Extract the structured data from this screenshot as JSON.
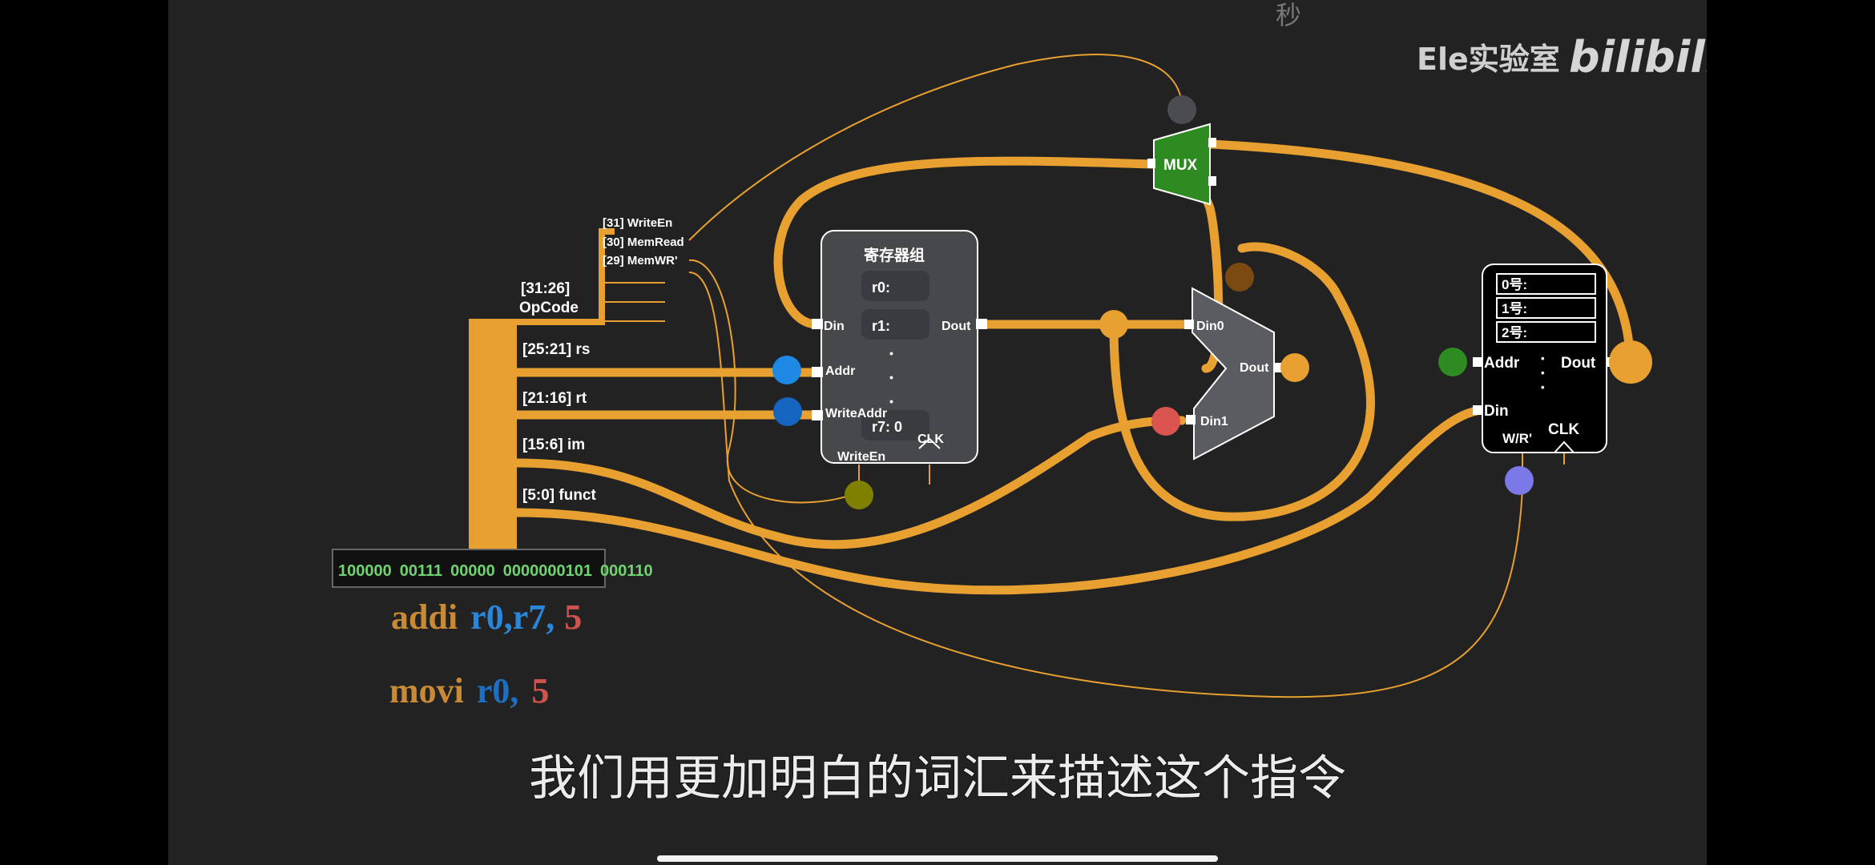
{
  "watermark": {
    "top_char": "秒",
    "channel": "Ele实验室",
    "brand": "bilibili"
  },
  "colors": {
    "wire": "#e8a030",
    "bg": "#222222",
    "mux": "#2e8b22",
    "reg_box": "#46484c",
    "alu": "#5a5c62",
    "ram_box": "#000000"
  },
  "instruction_bus": {
    "opcode_label": "[31:26]",
    "opcode_name": "OpCode",
    "opcode_bits": [
      "[31] WriteEn",
      "[30] MemRead",
      "[29] MemWR'"
    ],
    "fields": [
      "[25:21] rs",
      "[21:16] rt",
      "[15:6] im",
      "[5:0] funct"
    ],
    "binary": [
      "100000",
      "00111",
      "00000",
      "0000000101",
      "000110"
    ]
  },
  "register_file": {
    "title": "寄存器组",
    "rows": [
      "r0:",
      "r1:",
      "r7:  0"
    ],
    "dots": "•",
    "ports": {
      "din": "Din",
      "dout": "Dout",
      "addr": "Addr",
      "write_addr": "WriteAddr",
      "write_en": "WriteEn",
      "clk": "CLK"
    }
  },
  "mux": {
    "label": "MUX"
  },
  "alu": {
    "din0": "Din0",
    "din1": "Din1",
    "dout": "Dout"
  },
  "memory": {
    "rows": [
      "0号:",
      "1号:",
      "2号:"
    ],
    "dots": "•",
    "ports": {
      "addr": "Addr",
      "dout": "Dout",
      "din": "Din",
      "wr": "W/R'",
      "clk": "CLK"
    }
  },
  "assembly": {
    "line1": {
      "op": "addi",
      "r1": "r0,",
      "r2": "r7,",
      "imm": "5"
    },
    "line2": {
      "op": "movi",
      "r1": "r0,",
      "imm": "5"
    }
  },
  "subtitle": "我们用更加明白的词汇来描述这个指令"
}
